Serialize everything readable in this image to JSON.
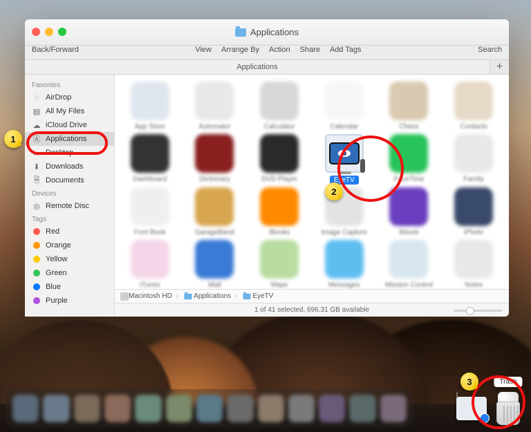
{
  "window": {
    "title": "Applications",
    "back_forward": "Back/Forward",
    "search": "Search",
    "menu": [
      "View",
      "Arrange By",
      "Action",
      "Share",
      "Add Tags"
    ],
    "tab_label": "Applications",
    "tab_add": "+"
  },
  "sidebar": {
    "sections": [
      {
        "title": "Favorites",
        "items": [
          {
            "id": "airdrop",
            "label": "AirDrop"
          },
          {
            "id": "allmyfiles",
            "label": "All My Files"
          },
          {
            "id": "iclouddrive",
            "label": "iCloud Drive"
          },
          {
            "id": "applications",
            "label": "Applications",
            "selected": true
          },
          {
            "id": "desktop",
            "label": "Desktop"
          },
          {
            "id": "downloads",
            "label": "Downloads"
          },
          {
            "id": "documents",
            "label": "Documents"
          }
        ]
      },
      {
        "title": "Devices",
        "items": [
          {
            "id": "remotedisc",
            "label": "Remote Disc"
          }
        ]
      },
      {
        "title": "Tags",
        "items": [
          {
            "id": "tag-red",
            "label": "Red",
            "color": "#ff5a52"
          },
          {
            "id": "tag-orange",
            "label": "Orange",
            "color": "#ff9500"
          },
          {
            "id": "tag-yellow",
            "label": "Yellow",
            "color": "#ffcc00"
          },
          {
            "id": "tag-green",
            "label": "Green",
            "color": "#34c759"
          },
          {
            "id": "tag-blue",
            "label": "Blue",
            "color": "#007aff"
          },
          {
            "id": "tag-purple",
            "label": "Purple",
            "color": "#af52de"
          }
        ]
      }
    ]
  },
  "apps": [
    {
      "label": "App Store",
      "bg": "#dfe6ee"
    },
    {
      "label": "Automator",
      "bg": "#e8e8e8"
    },
    {
      "label": "Calculator",
      "bg": "#d7d7d7"
    },
    {
      "label": "Calendar",
      "bg": "#f6f6f6"
    },
    {
      "label": "Chess",
      "bg": "#d9c9b0"
    },
    {
      "label": "Contacts",
      "bg": "#e7d9c7"
    },
    {
      "label": "Dashboard",
      "bg": "#333"
    },
    {
      "label": "Dictionary",
      "bg": "#8a1f1f"
    },
    {
      "label": "DVD Player",
      "bg": "#2a2a2a"
    },
    {
      "label": "EyeTV",
      "sharp": true
    },
    {
      "label": "FaceTime",
      "bg": "#28c35a"
    },
    {
      "label": "Family",
      "bg": "#e8e8e8"
    },
    {
      "label": "Font Book",
      "bg": "#efefef"
    },
    {
      "label": "GarageBand",
      "bg": "#d8a650"
    },
    {
      "label": "iBooks",
      "bg": "#ff8a00"
    },
    {
      "label": "Image Capture",
      "bg": "#e3e3e3"
    },
    {
      "label": "iMovie",
      "bg": "#6a3fbf"
    },
    {
      "label": "iPhoto",
      "bg": "#3a4a6a"
    },
    {
      "label": "iTunes",
      "bg": "#f4d6e8"
    },
    {
      "label": "Mail",
      "bg": "#3a7bd5"
    },
    {
      "label": "Maps",
      "bg": "#b9dca0"
    },
    {
      "label": "Messages",
      "bg": "#5fbef0"
    },
    {
      "label": "Mission Control",
      "bg": "#d8e6f0"
    },
    {
      "label": "Notes",
      "bg": "#e8e8e8"
    }
  ],
  "pathbar": [
    "Macintosh HD",
    "Applications",
    "EyeTV"
  ],
  "status": "1 of 41 selected, 696.31 GB available",
  "dock": {
    "trash_tooltip": "Trash",
    "swatches": [
      "#5a6a7a",
      "#6a7a8a",
      "#7a6a5a",
      "#8a6a5a",
      "#6a8a7a",
      "#7a8a6a",
      "#5a7a8a",
      "#6a6a6a",
      "#8a7a6a",
      "#7a7a7a",
      "#6a5a7a",
      "#5a6a6a",
      "#7a6a7a"
    ]
  },
  "annotations": {
    "1": "1",
    "2": "2",
    "3": "3"
  }
}
